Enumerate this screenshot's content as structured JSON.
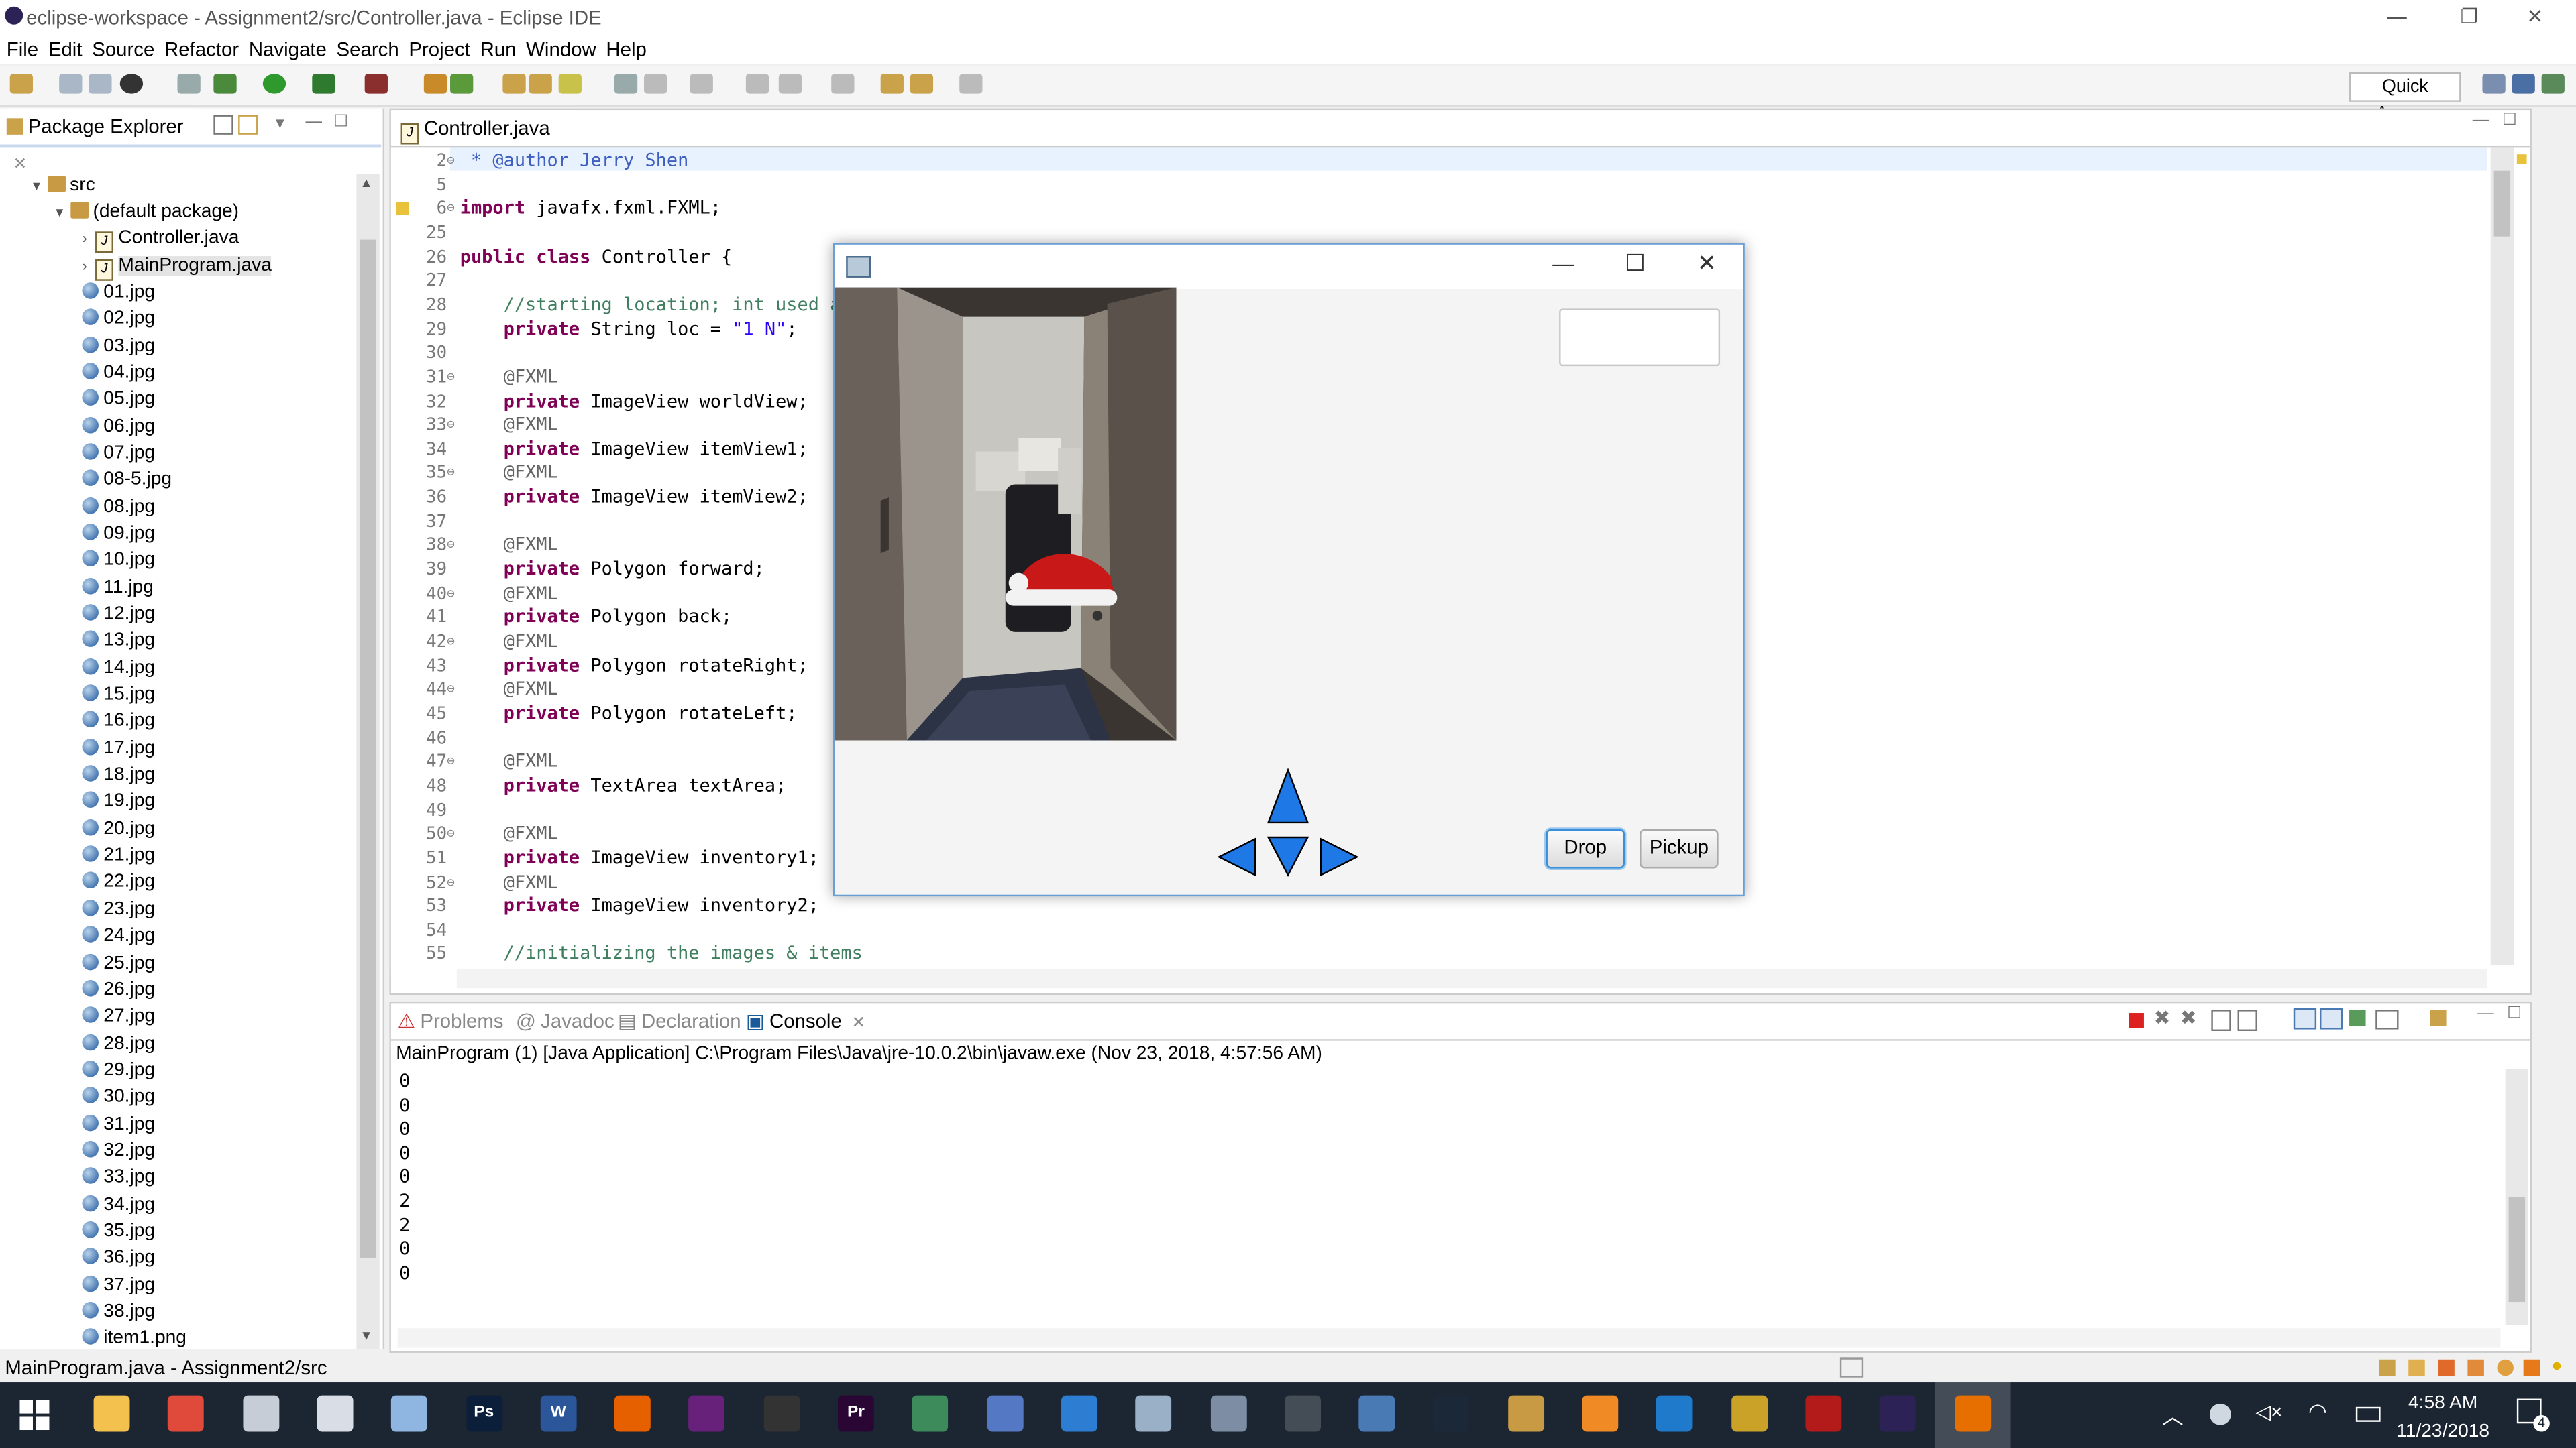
{
  "window": {
    "title": "eclipse-workspace - Assignment2/src/Controller.java - Eclipse IDE",
    "controls": [
      "—",
      "❐",
      "✕"
    ]
  },
  "menu": [
    "File",
    "Edit",
    "Source",
    "Refactor",
    "Navigate",
    "Search",
    "Project",
    "Run",
    "Window",
    "Help"
  ],
  "toolbar": {
    "quick_access": "Quick Access"
  },
  "package_explorer": {
    "tab_label": "Package Explorer",
    "src": "src",
    "default_package": "(default package)",
    "java_files": [
      "Controller.java",
      "MainProgram.java"
    ],
    "files": [
      "01.jpg",
      "02.jpg",
      "03.jpg",
      "04.jpg",
      "05.jpg",
      "06.jpg",
      "07.jpg",
      "08-5.jpg",
      "08.jpg",
      "09.jpg",
      "10.jpg",
      "11.jpg",
      "12.jpg",
      "13.jpg",
      "14.jpg",
      "15.jpg",
      "16.jpg",
      "17.jpg",
      "18.jpg",
      "19.jpg",
      "20.jpg",
      "21.jpg",
      "22.jpg",
      "23.jpg",
      "24.jpg",
      "25.jpg",
      "26.jpg",
      "27.jpg",
      "28.jpg",
      "29.jpg",
      "30.jpg",
      "31.jpg",
      "32.jpg",
      "33.jpg",
      "34.jpg",
      "35.jpg",
      "36.jpg",
      "37.jpg",
      "38.jpg",
      "item1.png"
    ]
  },
  "editor": {
    "tab_label": "Controller.java",
    "lines": [
      {
        "n": "2",
        "segs": [
          [
            "jd",
            " * @author Jerry Shen"
          ]
        ]
      },
      {
        "n": "5",
        "segs": []
      },
      {
        "n": "6",
        "segs": [
          [
            "kw",
            "import"
          ],
          [
            "",
            " javafx.fxml.FXML;"
          ]
        ]
      },
      {
        "n": "25",
        "segs": []
      },
      {
        "n": "26",
        "segs": [
          [
            "kw",
            "public class"
          ],
          [
            "",
            " Controller {"
          ]
        ]
      },
      {
        "n": "27",
        "segs": []
      },
      {
        "n": "28",
        "segs": [
          [
            "cm",
            "    //starting location; int used a"
          ]
        ]
      },
      {
        "n": "29",
        "segs": [
          [
            "kw",
            "    private"
          ],
          [
            "",
            " String loc = "
          ],
          [
            "st",
            "\"1 N\""
          ],
          [
            "",
            ";"
          ]
        ]
      },
      {
        "n": "30",
        "segs": []
      },
      {
        "n": "31",
        "segs": [
          [
            "an",
            "    @FXML"
          ]
        ]
      },
      {
        "n": "32",
        "segs": [
          [
            "kw",
            "    private"
          ],
          [
            "",
            " ImageView worldView;"
          ]
        ]
      },
      {
        "n": "33",
        "segs": [
          [
            "an",
            "    @FXML"
          ]
        ]
      },
      {
        "n": "34",
        "segs": [
          [
            "kw",
            "    private"
          ],
          [
            "",
            " ImageView itemView1;"
          ]
        ]
      },
      {
        "n": "35",
        "segs": [
          [
            "an",
            "    @FXML"
          ]
        ]
      },
      {
        "n": "36",
        "segs": [
          [
            "kw",
            "    private"
          ],
          [
            "",
            " ImageView itemView2;"
          ]
        ]
      },
      {
        "n": "37",
        "segs": []
      },
      {
        "n": "38",
        "segs": [
          [
            "an",
            "    @FXML"
          ]
        ]
      },
      {
        "n": "39",
        "segs": [
          [
            "kw",
            "    private"
          ],
          [
            "",
            " Polygon forward;"
          ]
        ]
      },
      {
        "n": "40",
        "segs": [
          [
            "an",
            "    @FXML"
          ]
        ]
      },
      {
        "n": "41",
        "segs": [
          [
            "kw",
            "    private"
          ],
          [
            "",
            " Polygon back;"
          ]
        ]
      },
      {
        "n": "42",
        "segs": [
          [
            "an",
            "    @FXML"
          ]
        ]
      },
      {
        "n": "43",
        "segs": [
          [
            "kw",
            "    private"
          ],
          [
            "",
            " Polygon rotateRight;"
          ]
        ]
      },
      {
        "n": "44",
        "segs": [
          [
            "an",
            "    @FXML"
          ]
        ]
      },
      {
        "n": "45",
        "segs": [
          [
            "kw",
            "    private"
          ],
          [
            "",
            " Polygon rotateLeft;"
          ]
        ]
      },
      {
        "n": "46",
        "segs": []
      },
      {
        "n": "47",
        "segs": [
          [
            "an",
            "    @FXML"
          ]
        ]
      },
      {
        "n": "48",
        "segs": [
          [
            "kw",
            "    private"
          ],
          [
            "",
            " TextArea textArea;"
          ]
        ]
      },
      {
        "n": "49",
        "segs": []
      },
      {
        "n": "50",
        "segs": [
          [
            "an",
            "    @FXML"
          ]
        ]
      },
      {
        "n": "51",
        "segs": [
          [
            "kw",
            "    private"
          ],
          [
            "",
            " ImageView inventory1;"
          ]
        ]
      },
      {
        "n": "52",
        "segs": [
          [
            "an",
            "    @FXML"
          ]
        ]
      },
      {
        "n": "53",
        "segs": [
          [
            "kw",
            "    private"
          ],
          [
            "",
            " ImageView inventory2;"
          ]
        ]
      },
      {
        "n": "54",
        "segs": []
      },
      {
        "n": "55",
        "segs": [
          [
            "cm",
            "    //initializing the images & items"
          ]
        ]
      }
    ]
  },
  "bottom_tabs": [
    "Problems",
    "Javadoc",
    "Declaration",
    "Console"
  ],
  "console": {
    "header": "MainProgram (1) [Java Application] C:\\Program Files\\Java\\jre-10.0.2\\bin\\javaw.exe (Nov 23, 2018, 4:57:56 AM)",
    "lines": [
      "0",
      "0",
      "0",
      "0",
      "0",
      "2",
      "2",
      "0",
      "0"
    ]
  },
  "status": {
    "text": "MainProgram.java - Assignment2/src"
  },
  "fx_app": {
    "controls": [
      "—",
      "☐",
      "✕"
    ],
    "drop_label": "Drop",
    "pickup_label": "Pickup",
    "textfield_value": ""
  },
  "taskbar": {
    "time": "4:58 AM",
    "date": "11/23/2018",
    "notification_count": "4",
    "apps": [
      {
        "name": "file-explorer",
        "glyph": "",
        "color": "#f2c14e"
      },
      {
        "name": "chrome",
        "glyph": "",
        "color": "#e04a3a"
      },
      {
        "name": "file-manager",
        "glyph": "",
        "color": "#c6cdd6"
      },
      {
        "name": "notepad",
        "glyph": "",
        "color": "#d8dde6"
      },
      {
        "name": "mail",
        "glyph": "",
        "color": "#8fb6e0"
      },
      {
        "name": "photoshop",
        "glyph": "Ps",
        "color": "#0b1f3a"
      },
      {
        "name": "word",
        "glyph": "W",
        "color": "#2b579a"
      },
      {
        "name": "firefox",
        "glyph": "",
        "color": "#e66000"
      },
      {
        "name": "visual-studio",
        "glyph": "",
        "color": "#68217a"
      },
      {
        "name": "github",
        "glyph": "",
        "color": "#333333"
      },
      {
        "name": "premiere",
        "glyph": "Pr",
        "color": "#2a0634"
      },
      {
        "name": "globe-app",
        "glyph": "",
        "color": "#3d8b5a"
      },
      {
        "name": "network-app",
        "glyph": "",
        "color": "#5578c4"
      },
      {
        "name": "terminal-app",
        "glyph": "",
        "color": "#2d7dd2"
      },
      {
        "name": "box-app",
        "glyph": "",
        "color": "#9ab0c6"
      },
      {
        "name": "app-16",
        "glyph": "",
        "color": "#7d8ea4"
      },
      {
        "name": "console-app",
        "glyph": "",
        "color": "#444c56"
      },
      {
        "name": "app-18",
        "glyph": "",
        "color": "#4a7ab4"
      },
      {
        "name": "steam",
        "glyph": "",
        "color": "#1b2838"
      },
      {
        "name": "app-20",
        "glyph": "",
        "color": "#c99a44"
      },
      {
        "name": "app-21",
        "glyph": "",
        "color": "#f08a24"
      },
      {
        "name": "vscode",
        "glyph": "",
        "color": "#1f7acc"
      },
      {
        "name": "app-23",
        "glyph": "",
        "color": "#c9a227"
      },
      {
        "name": "app-24",
        "glyph": "",
        "color": "#b31b1b"
      },
      {
        "name": "eclipse",
        "glyph": "",
        "color": "#2c2255"
      },
      {
        "name": "java",
        "glyph": "",
        "color": "#e76f00"
      }
    ]
  },
  "colors": {
    "arrow_fill": "#1e78e6",
    "keyword": "#7f0055",
    "comment": "#3f7f5f",
    "string": "#2a00ff",
    "taskbar": "#1c2532"
  }
}
